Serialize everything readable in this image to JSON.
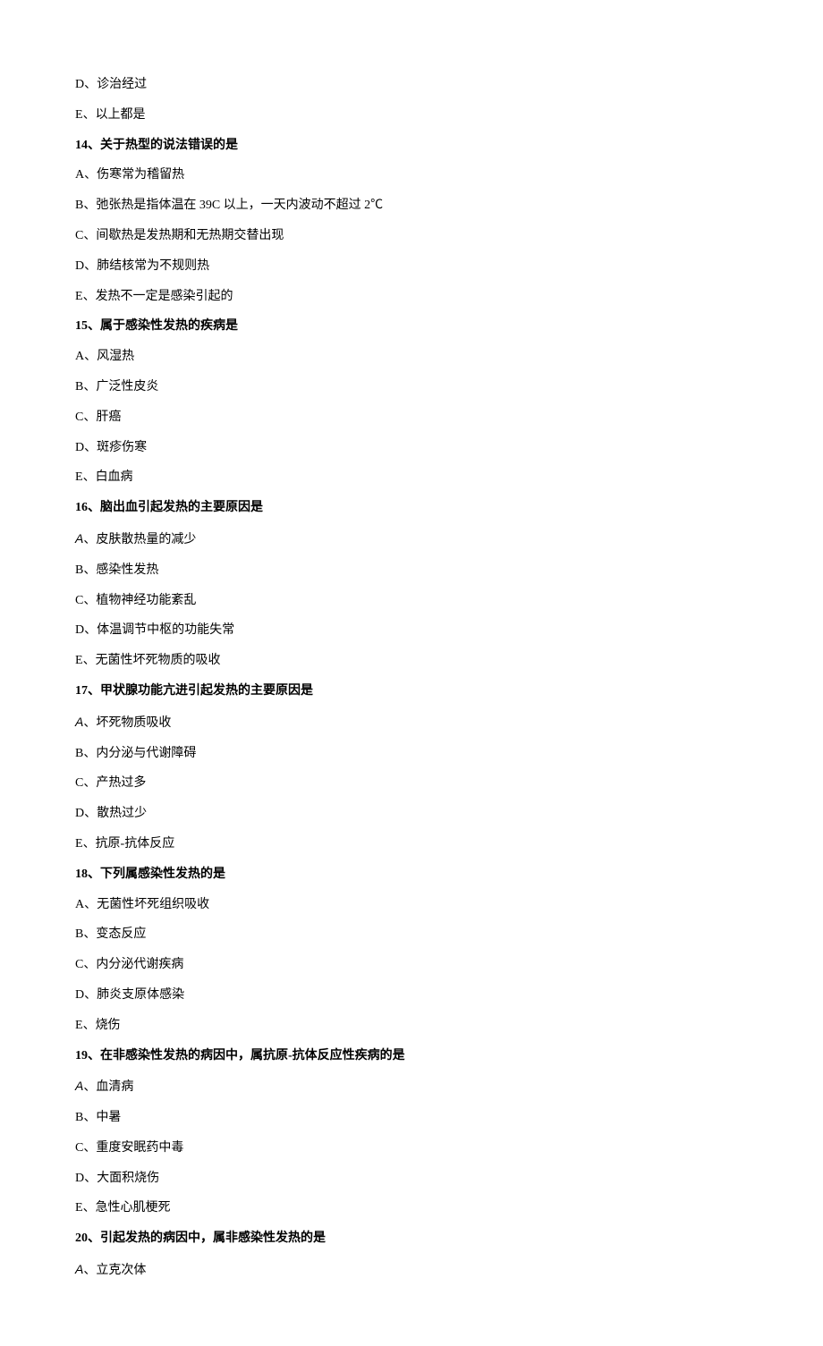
{
  "lead_options": [
    {
      "letter": "D",
      "text": "诊治经过"
    },
    {
      "letter": "E",
      "text": "以上都是"
    }
  ],
  "questions": [
    {
      "num": "14",
      "stem": "关于热型的说法错误的是",
      "options": [
        {
          "letter": "A",
          "text": "伤寒常为稽留热"
        },
        {
          "letter": "B",
          "text": "弛张热是指体温在 39C 以上，一天内波动不超过 2℃"
        },
        {
          "letter": "C",
          "text": "间歇热是发热期和无热期交替出现"
        },
        {
          "letter": "D",
          "text": "肺结核常为不规则热"
        },
        {
          "letter": "E",
          "text": "发热不一定是感染引起的"
        }
      ]
    },
    {
      "num": "15",
      "stem": "属于感染性发热的疾病是",
      "options": [
        {
          "letter": "A",
          "text": "风湿热"
        },
        {
          "letter": "B",
          "text": "广泛性皮炎"
        },
        {
          "letter": "C",
          "text": "肝癌"
        },
        {
          "letter": "D",
          "text": "斑疹伤寒"
        },
        {
          "letter": "E",
          "text": "白血病"
        }
      ]
    },
    {
      "num": "16",
      "stem": "脑出血引起发热的主要原因是",
      "options": [
        {
          "letter": "A",
          "text": "皮肤散热量的减少",
          "sans": true
        },
        {
          "letter": "B",
          "text": "感染性发热"
        },
        {
          "letter": "C",
          "text": "植物神经功能紊乱"
        },
        {
          "letter": "D",
          "text": "体温调节中枢的功能失常"
        },
        {
          "letter": "E",
          "text": "无菌性坏死物质的吸收"
        }
      ]
    },
    {
      "num": "17",
      "stem": "甲状腺功能亢进引起发热的主要原因是",
      "options": [
        {
          "letter": "A",
          "text": "坏死物质吸收",
          "sans": true
        },
        {
          "letter": "B",
          "text": "内分泌与代谢障碍"
        },
        {
          "letter": "C",
          "text": "产热过多"
        },
        {
          "letter": "D",
          "text": "散热过少"
        },
        {
          "letter": "E",
          "text": "抗原-抗体反应"
        }
      ]
    },
    {
      "num": "18",
      "stem": "下列属感染性发热的是",
      "options": [
        {
          "letter": "A",
          "text": "无菌性坏死组织吸收"
        },
        {
          "letter": "B",
          "text": "变态反应"
        },
        {
          "letter": "C",
          "text": "内分泌代谢疾病"
        },
        {
          "letter": "D",
          "text": "肺炎支原体感染"
        },
        {
          "letter": "E",
          "text": "烧伤"
        }
      ]
    },
    {
      "num": "19",
      "stem": "在非感染性发热的病因中，属抗原-抗体反应性疾病的是",
      "options": [
        {
          "letter": "A",
          "text": "血清病",
          "sans": true
        },
        {
          "letter": "B",
          "text": "中暑"
        },
        {
          "letter": "C",
          "text": "重度安眠药中毒"
        },
        {
          "letter": "D",
          "text": "大面积烧伤"
        },
        {
          "letter": "E",
          "text": "急性心肌梗死"
        }
      ]
    },
    {
      "num": "20",
      "stem": "引起发热的病因中，属非感染性发热的是",
      "options": [
        {
          "letter": "A",
          "text": "立克次体",
          "sans": true
        }
      ]
    }
  ]
}
